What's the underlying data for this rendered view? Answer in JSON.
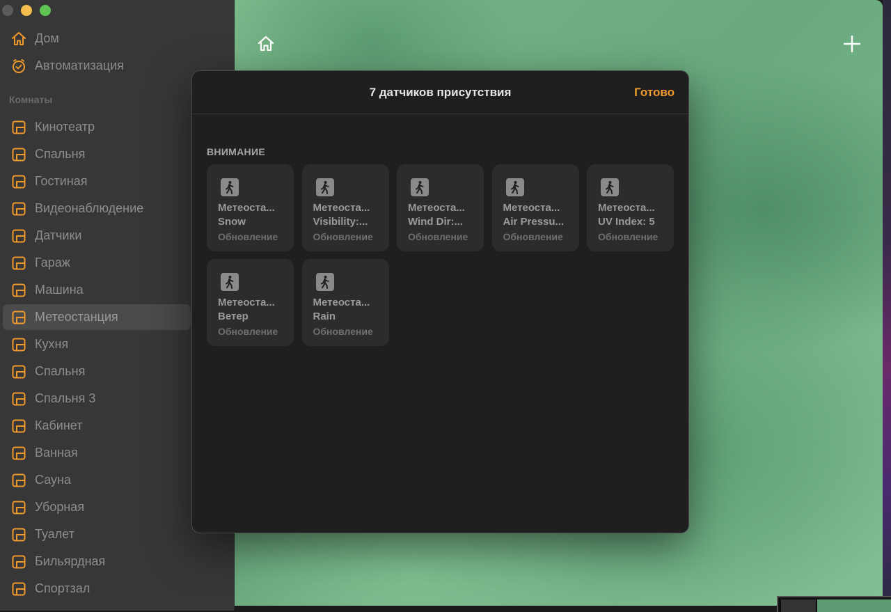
{
  "sidebar": {
    "nav": [
      {
        "label": "Дом",
        "icon": "house-icon"
      },
      {
        "label": "Автоматизация",
        "icon": "clock-check-icon"
      }
    ],
    "rooms_heading": "Комнаты",
    "rooms": [
      {
        "label": "Кинотеатр",
        "selected": false
      },
      {
        "label": "Спальня",
        "selected": false
      },
      {
        "label": "Гостиная",
        "selected": false
      },
      {
        "label": "Видеонаблюдение",
        "selected": false
      },
      {
        "label": "Датчики",
        "selected": false
      },
      {
        "label": "Гараж",
        "selected": false
      },
      {
        "label": "Машина",
        "selected": false
      },
      {
        "label": "Метеостанция",
        "selected": true
      },
      {
        "label": "Кухня",
        "selected": false
      },
      {
        "label": "Спальня",
        "selected": false
      },
      {
        "label": "Спальня 3",
        "selected": false
      },
      {
        "label": "Кабинет",
        "selected": false
      },
      {
        "label": "Ванная",
        "selected": false
      },
      {
        "label": "Сауна",
        "selected": false
      },
      {
        "label": "Уборная",
        "selected": false
      },
      {
        "label": "Туалет",
        "selected": false
      },
      {
        "label": "Бильярдная",
        "selected": false
      },
      {
        "label": "Спортзал",
        "selected": false
      }
    ]
  },
  "modal": {
    "title": "7 датчиков присутствия",
    "done_label": "Готово",
    "section_title": "ВНИМАНИЕ",
    "tiles": [
      {
        "name": "Метеоста...",
        "value": "Snow",
        "status": "Обновление"
      },
      {
        "name": "Метеоста...",
        "value": "Visibility:...",
        "status": "Обновление"
      },
      {
        "name": "Метеоста...",
        "value": "Wind Dir:...",
        "status": "Обновление"
      },
      {
        "name": "Метеоста...",
        "value": "Air Pressu...",
        "status": "Обновление"
      },
      {
        "name": "Метеоста...",
        "value": "UV Index: 5",
        "status": "Обновление"
      },
      {
        "name": "Метеоста...",
        "value": "Ветер",
        "status": "Обновление"
      },
      {
        "name": "Метеоста...",
        "value": "Rain",
        "status": "Обновление"
      }
    ]
  },
  "colors": {
    "accent": "#f19a2c",
    "sidebar_bg": "#373737",
    "modal_bg": "#1f1f1f",
    "tile_bg": "#2c2c2c"
  }
}
